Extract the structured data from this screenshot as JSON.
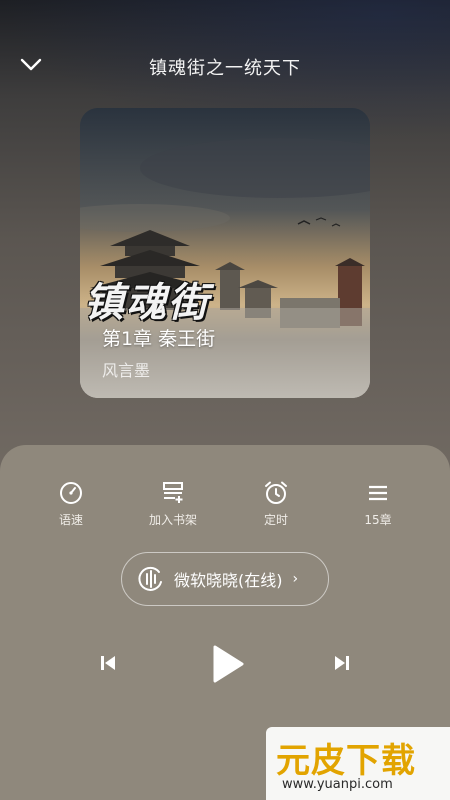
{
  "header": {
    "title": "镇魂街之一统天下"
  },
  "cover": {
    "logo_text": "镇魂街",
    "chapter": "第1章 秦王街",
    "author": "风言墨"
  },
  "toolbar": {
    "items": [
      {
        "label": "语速",
        "icon": "speed-gauge-icon"
      },
      {
        "label": "加入书架",
        "icon": "bookshelf-icon"
      },
      {
        "label": "定时",
        "icon": "alarm-clock-icon"
      },
      {
        "label": "15章",
        "icon": "chapter-list-icon"
      }
    ]
  },
  "voice": {
    "label": "微软晓晓(在线)",
    "chevron": "›"
  },
  "player": {
    "prev_icon": "skip-previous-icon",
    "play_icon": "play-icon",
    "next_icon": "skip-next-icon"
  },
  "watermark": {
    "brand": "元皮下载",
    "url": "www.yuanpi.com",
    "color": "#e2a400"
  }
}
